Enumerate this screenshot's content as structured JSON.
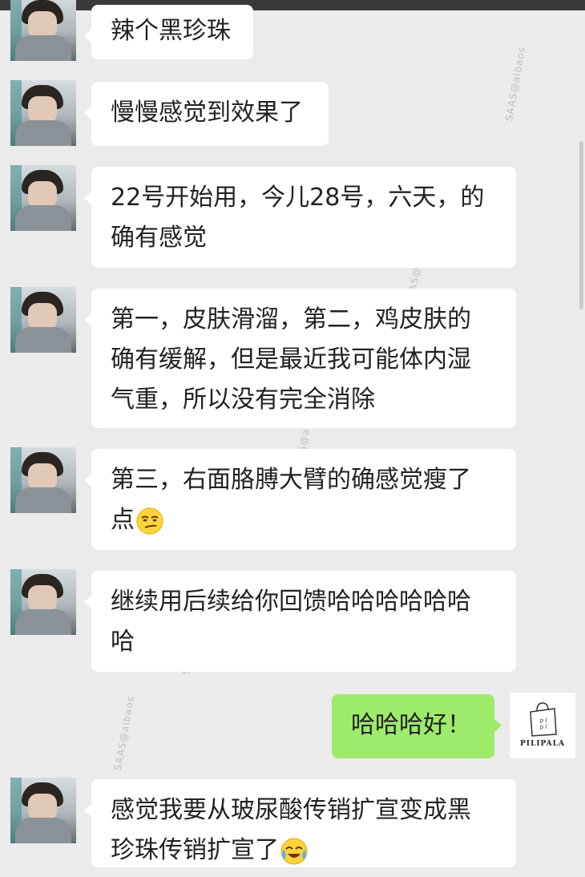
{
  "watermark": "SAAS@aibaos",
  "messages": [
    {
      "side": "left",
      "text": "辣个黑珍珠"
    },
    {
      "side": "left",
      "text": "慢慢感觉到效果了"
    },
    {
      "side": "left",
      "line1": "22号开始用，今儿28号，六天，的",
      "line2": "确有感觉"
    },
    {
      "side": "left",
      "line1": "第一，皮肤滑溜，第二，鸡皮肤的",
      "line2": "确有缓解，但是最近我可能体内湿",
      "line3": "气重，所以没有完全消除"
    },
    {
      "side": "left",
      "line1": "第三，右面胳膊大臂的确感觉瘦了",
      "line2": "点",
      "emoji": "smirk-emoji"
    },
    {
      "side": "left",
      "line1": "继续用后续给你回馈哈哈哈哈哈哈",
      "line2": "哈"
    },
    {
      "side": "right",
      "text": "哈哈哈好！"
    },
    {
      "side": "left",
      "line1": "感觉我要从玻尿酸传销扩宣变成黑",
      "line2": "珍珠传销扩宣了",
      "emoji": "laugh-cry-emoji"
    }
  ],
  "self_avatar": {
    "brand": "PILIPALA",
    "bag_text": "噼里啪啦"
  },
  "colors": {
    "background": "#ebebeb",
    "bubble_in": "#ffffff",
    "bubble_out": "#9eea6a"
  }
}
